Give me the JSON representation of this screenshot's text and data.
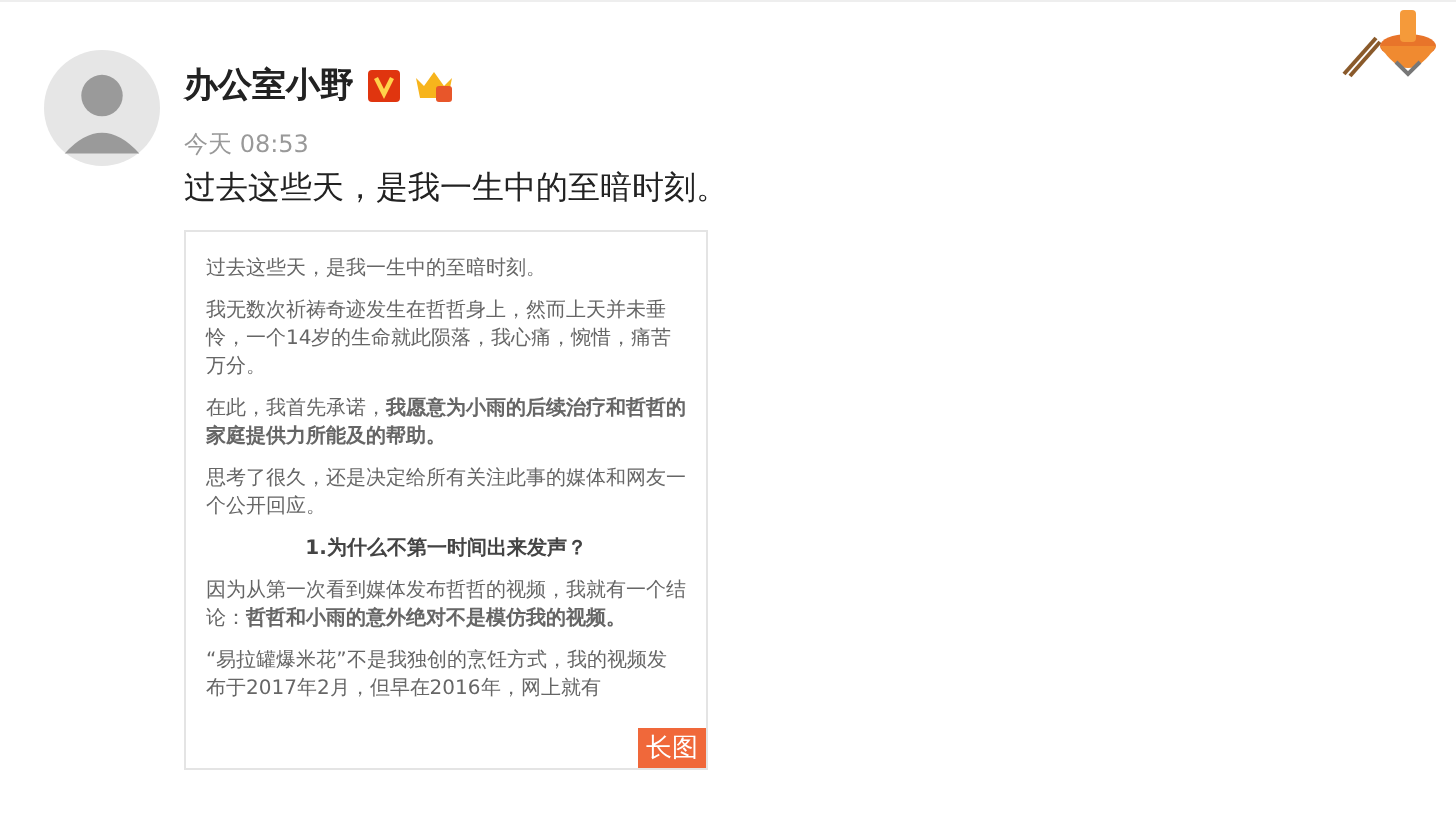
{
  "post": {
    "author": "办公室小野",
    "verified": true,
    "time": "今天 08:53",
    "text": "过去这些天，是我一生中的至暗时刻。"
  },
  "long_image": {
    "badge": "长图",
    "blocks": [
      {
        "kind": "para",
        "text": "过去这些天，是我一生中的至暗时刻。"
      },
      {
        "kind": "para",
        "text": "我无数次祈祷奇迹发生在哲哲身上，然而上天并未垂怜，一个14岁的生命就此陨落，我心痛，惋惜，痛苦万分。"
      },
      {
        "kind": "para",
        "text": "在此，我首先承诺，**我愿意为小雨的后续治疗和哲哲的家庭提供力所能及的帮助。**"
      },
      {
        "kind": "para",
        "text": "思考了很久，还是决定给所有关注此事的媒体和网友一个公开回应。"
      },
      {
        "kind": "heading",
        "text": "1.为什么不第一时间出来发声？"
      },
      {
        "kind": "para",
        "text": "因为从第一次看到媒体发布哲哲的视频，我就有一个结论：**哲哲和小雨的意外绝对不是模仿我的视频。**"
      },
      {
        "kind": "para",
        "text": "“易拉罐爆米花”不是我独创的烹饪方式，我的视频发布于2017年2月，但早在2016年，网上就有"
      }
    ]
  }
}
